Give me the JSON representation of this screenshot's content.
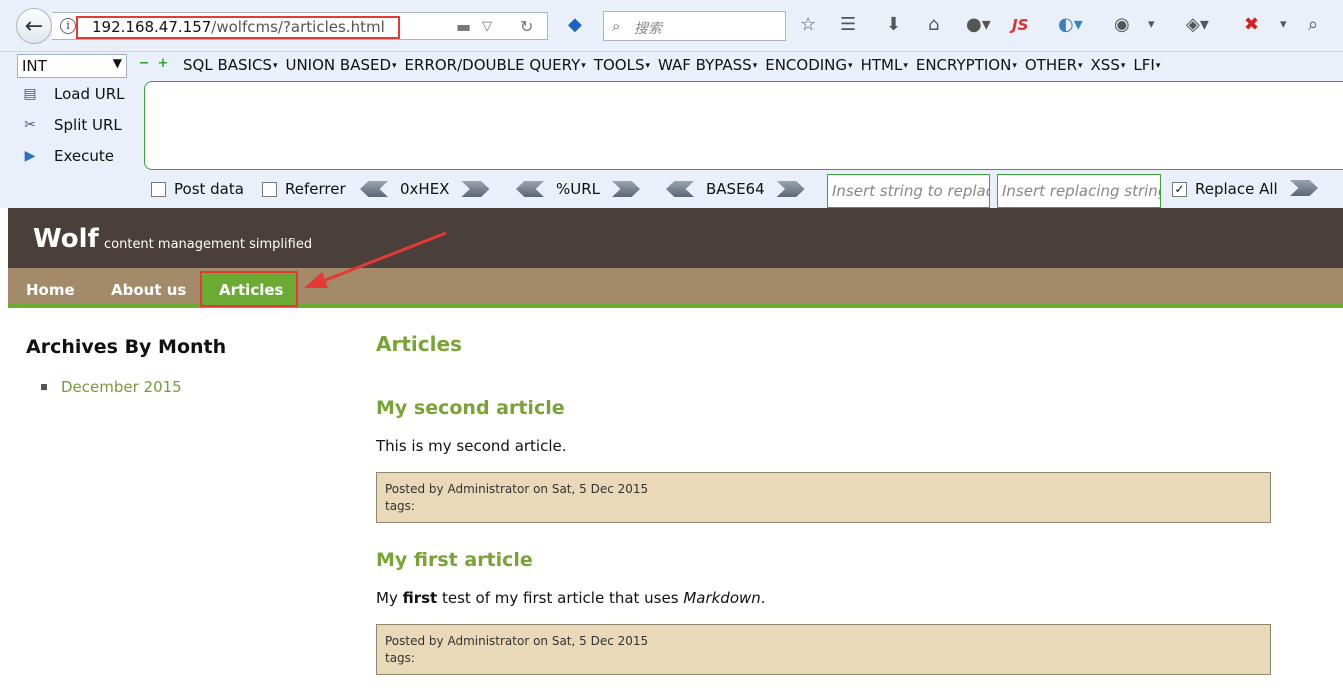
{
  "browser": {
    "url_host": "192.168.47.157",
    "url_path": "/wolfcms/?articles.html",
    "search_placeholder": "搜索",
    "js_icon_label": "JS"
  },
  "hackbar": {
    "select_value": "INT",
    "menus": [
      "SQL BASICS",
      "UNION BASED",
      "ERROR/DOUBLE QUERY",
      "TOOLS",
      "WAF BYPASS",
      "ENCODING",
      "HTML",
      "ENCRYPTION",
      "OTHER",
      "XSS",
      "LFI"
    ],
    "load_url": "Load URL",
    "split_url": "Split URL",
    "execute": "Execute",
    "post_data": "Post data",
    "referrer": "Referrer",
    "hex": "0xHEX",
    "url_enc": "%URL",
    "base64": "BASE64",
    "find_placeholder": "Insert string to replace",
    "replace_placeholder": "Insert replacing string",
    "replace_all": "Replace All"
  },
  "site": {
    "title": "Wolf",
    "slogan": "content management simplified",
    "nav": [
      "Home",
      "About us",
      "Articles"
    ]
  },
  "sidebar": {
    "title": "Archives By Month",
    "items": [
      "December 2015"
    ]
  },
  "content": {
    "title": "Articles",
    "articles": [
      {
        "title": "My second article",
        "body": "This is my second article.",
        "meta": "Posted by Administrator on Sat, 5 Dec 2015",
        "tags": "tags:"
      },
      {
        "title": "My first article",
        "body_pre": "My ",
        "body_bold": "first",
        "body_mid": " test of my first article that uses ",
        "body_em": "Markdown",
        "body_post": ".",
        "meta": "Posted by Administrator on Sat, 5 Dec 2015",
        "tags": "tags:"
      }
    ]
  },
  "colors": {
    "accent_green": "#6bab33",
    "header_brown": "#4a3f3a",
    "nav_tan": "#a38a68",
    "annotation_red": "#e53935"
  }
}
